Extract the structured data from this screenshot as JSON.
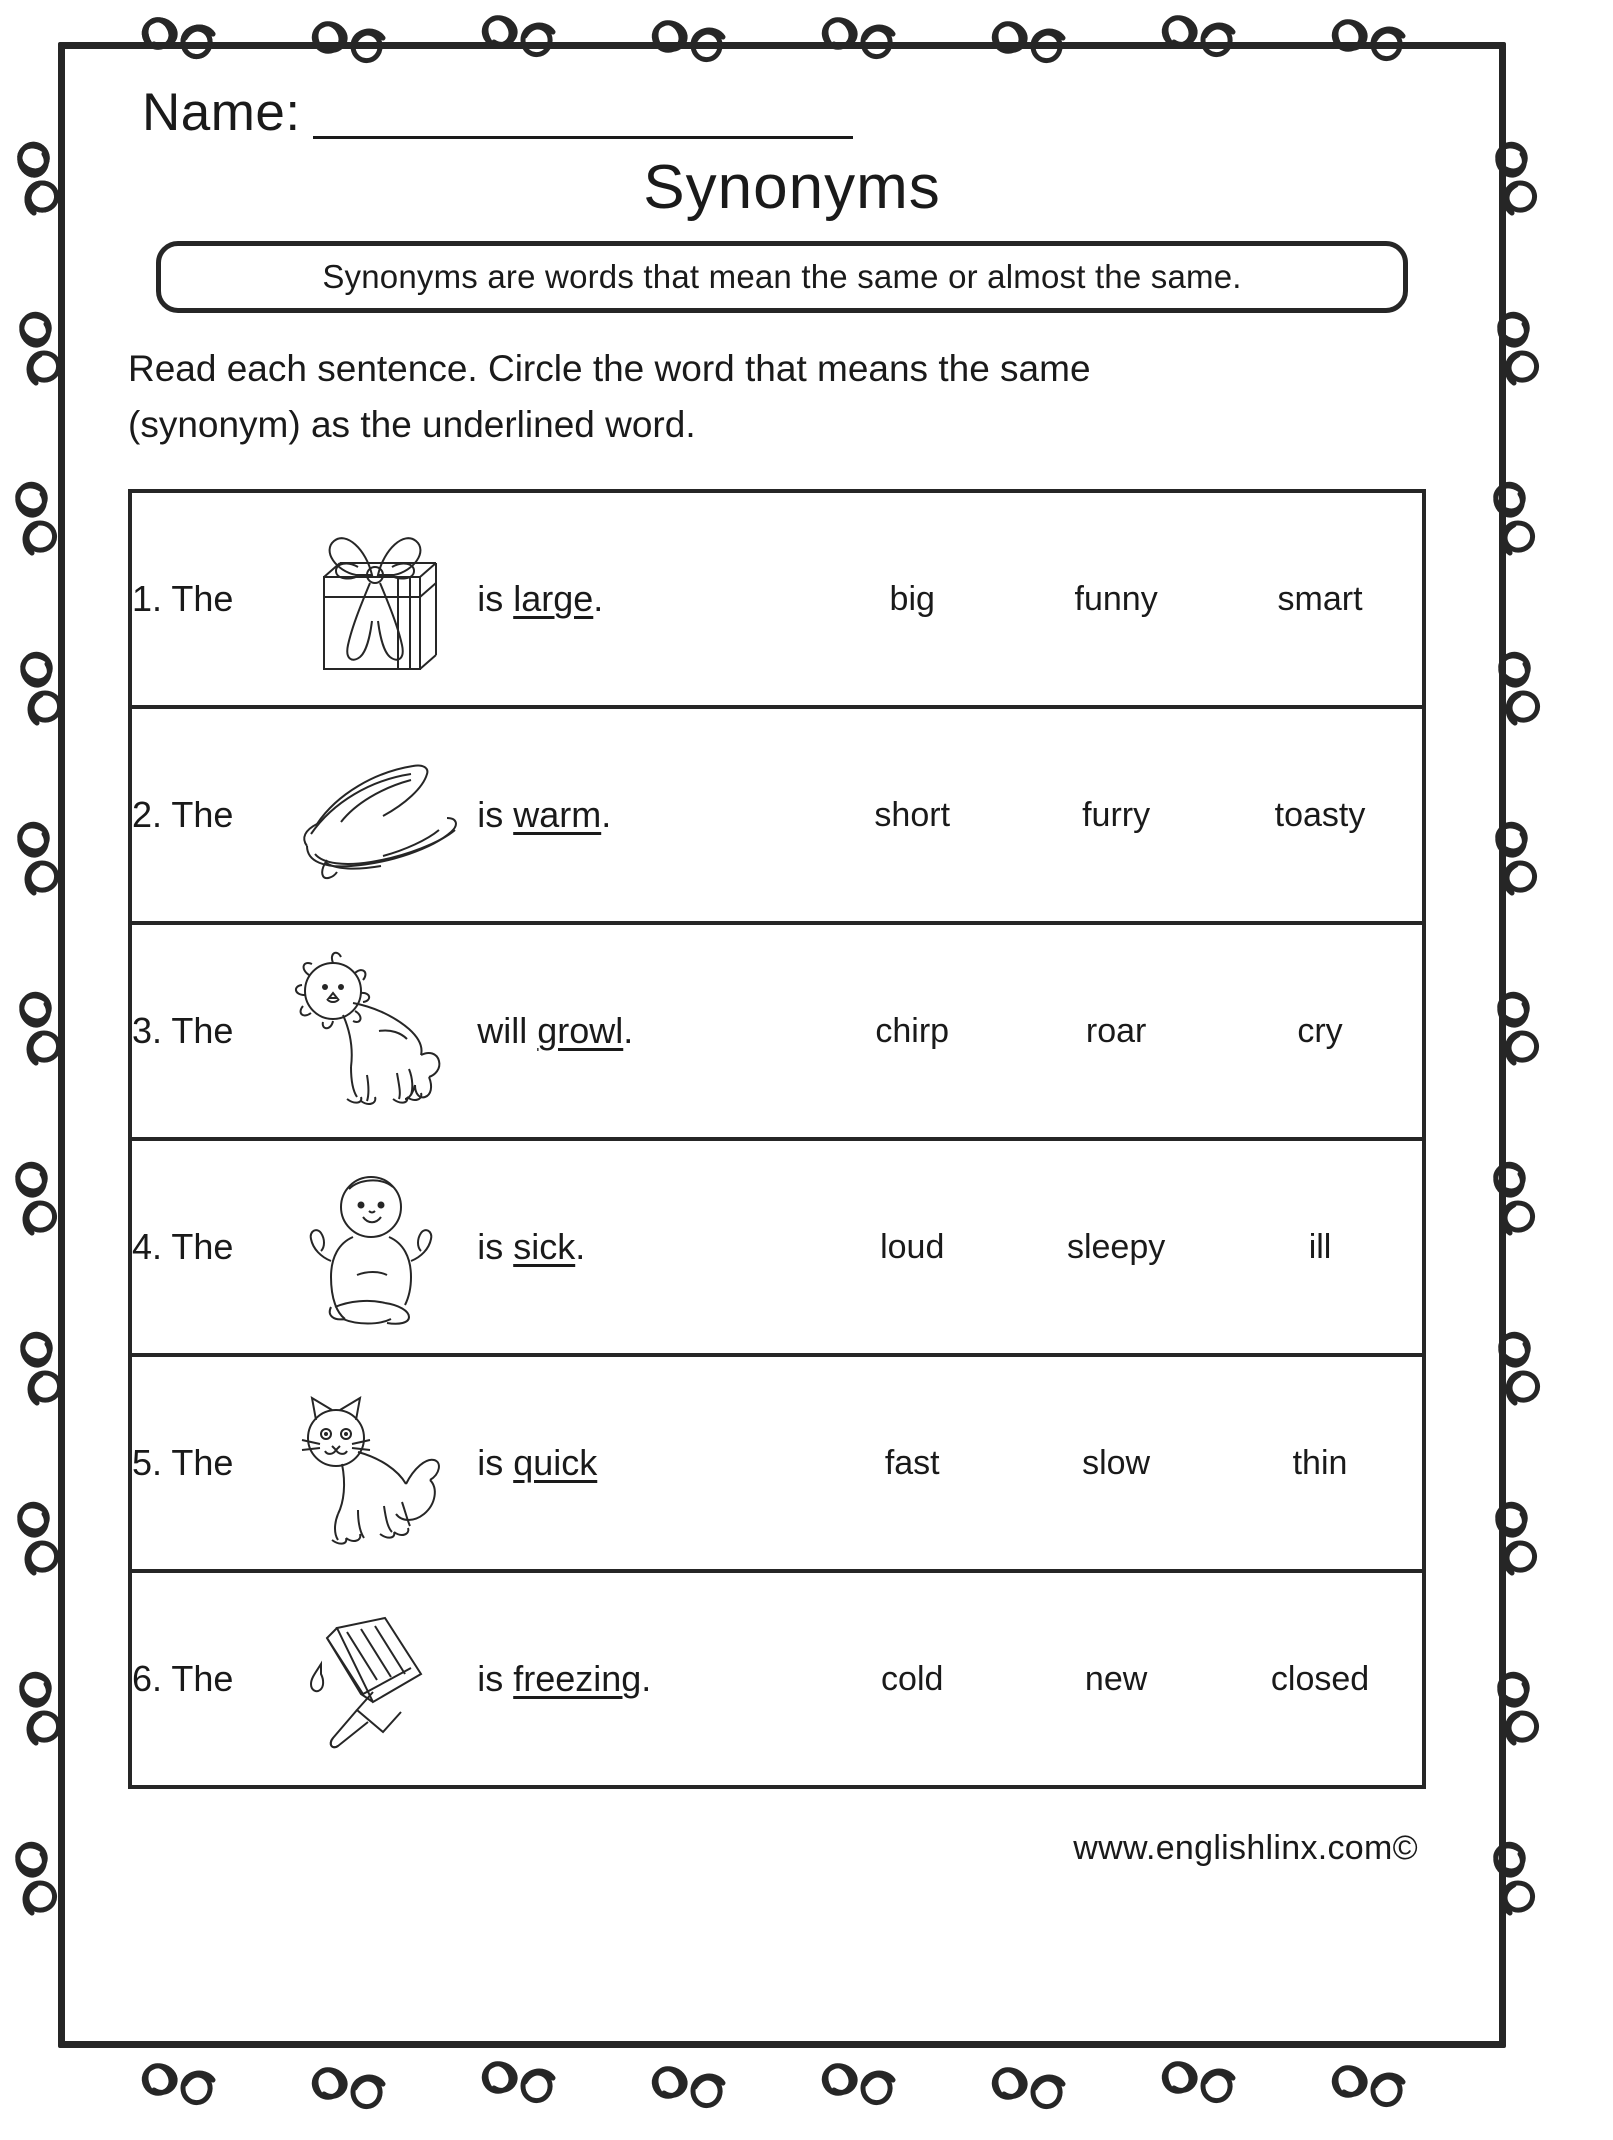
{
  "page": {
    "name_label": "Name:",
    "name_blank": "______________________",
    "title": "Synonyms",
    "definition": "Synonyms are words that mean the same or almost the same.",
    "directions_line1": "Read each sentence. Circle the word that means the same",
    "directions_line2": "(synonym) as the underlined word.",
    "footer": "www.englishlinx.com©"
  },
  "questions": [
    {
      "number": "1. The",
      "image": "gift-box",
      "sentence_prefix": "is ",
      "keyword": "large",
      "sentence_suffix": ".",
      "options": [
        "big",
        "funny",
        "smart"
      ]
    },
    {
      "number": "2. The",
      "image": "blanket",
      "sentence_prefix": "is ",
      "keyword": "warm",
      "sentence_suffix": ".",
      "options": [
        "short",
        "furry",
        "toasty"
      ]
    },
    {
      "number": "3. The",
      "image": "lion",
      "sentence_prefix": "will ",
      "keyword": "growl",
      "sentence_suffix": ".",
      "options": [
        "chirp",
        "roar",
        "cry"
      ]
    },
    {
      "number": "4. The",
      "image": "baby",
      "sentence_prefix": "is ",
      "keyword": "sick",
      "sentence_suffix": ".",
      "options": [
        "loud",
        "sleepy",
        "ill"
      ]
    },
    {
      "number": "5. The",
      "image": "kitten",
      "sentence_prefix": "is ",
      "keyword": "quick",
      "sentence_suffix": "",
      "options": [
        "fast",
        "slow",
        "thin"
      ]
    },
    {
      "number": "6. The",
      "image": "popsicle",
      "sentence_prefix": "is ",
      "keyword": "freezing",
      "sentence_suffix": ".",
      "options": [
        "cold",
        "new",
        "closed"
      ]
    }
  ]
}
